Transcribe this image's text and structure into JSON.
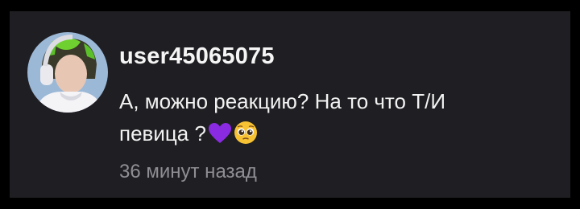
{
  "comment": {
    "username": "user45065075",
    "text_line_1": "А, можно реакцию? На то что Т/И",
    "text_line_2": "певица ?",
    "emojis": [
      "purple-heart",
      "pleading-face"
    ],
    "timestamp": "36 минут назад"
  },
  "colors": {
    "background": "#000000",
    "card": "#1f1e22",
    "text": "#f2f2f2",
    "muted": "#8f8e94",
    "heart": "#8a2be2",
    "emoji_face": "#f7c234"
  }
}
